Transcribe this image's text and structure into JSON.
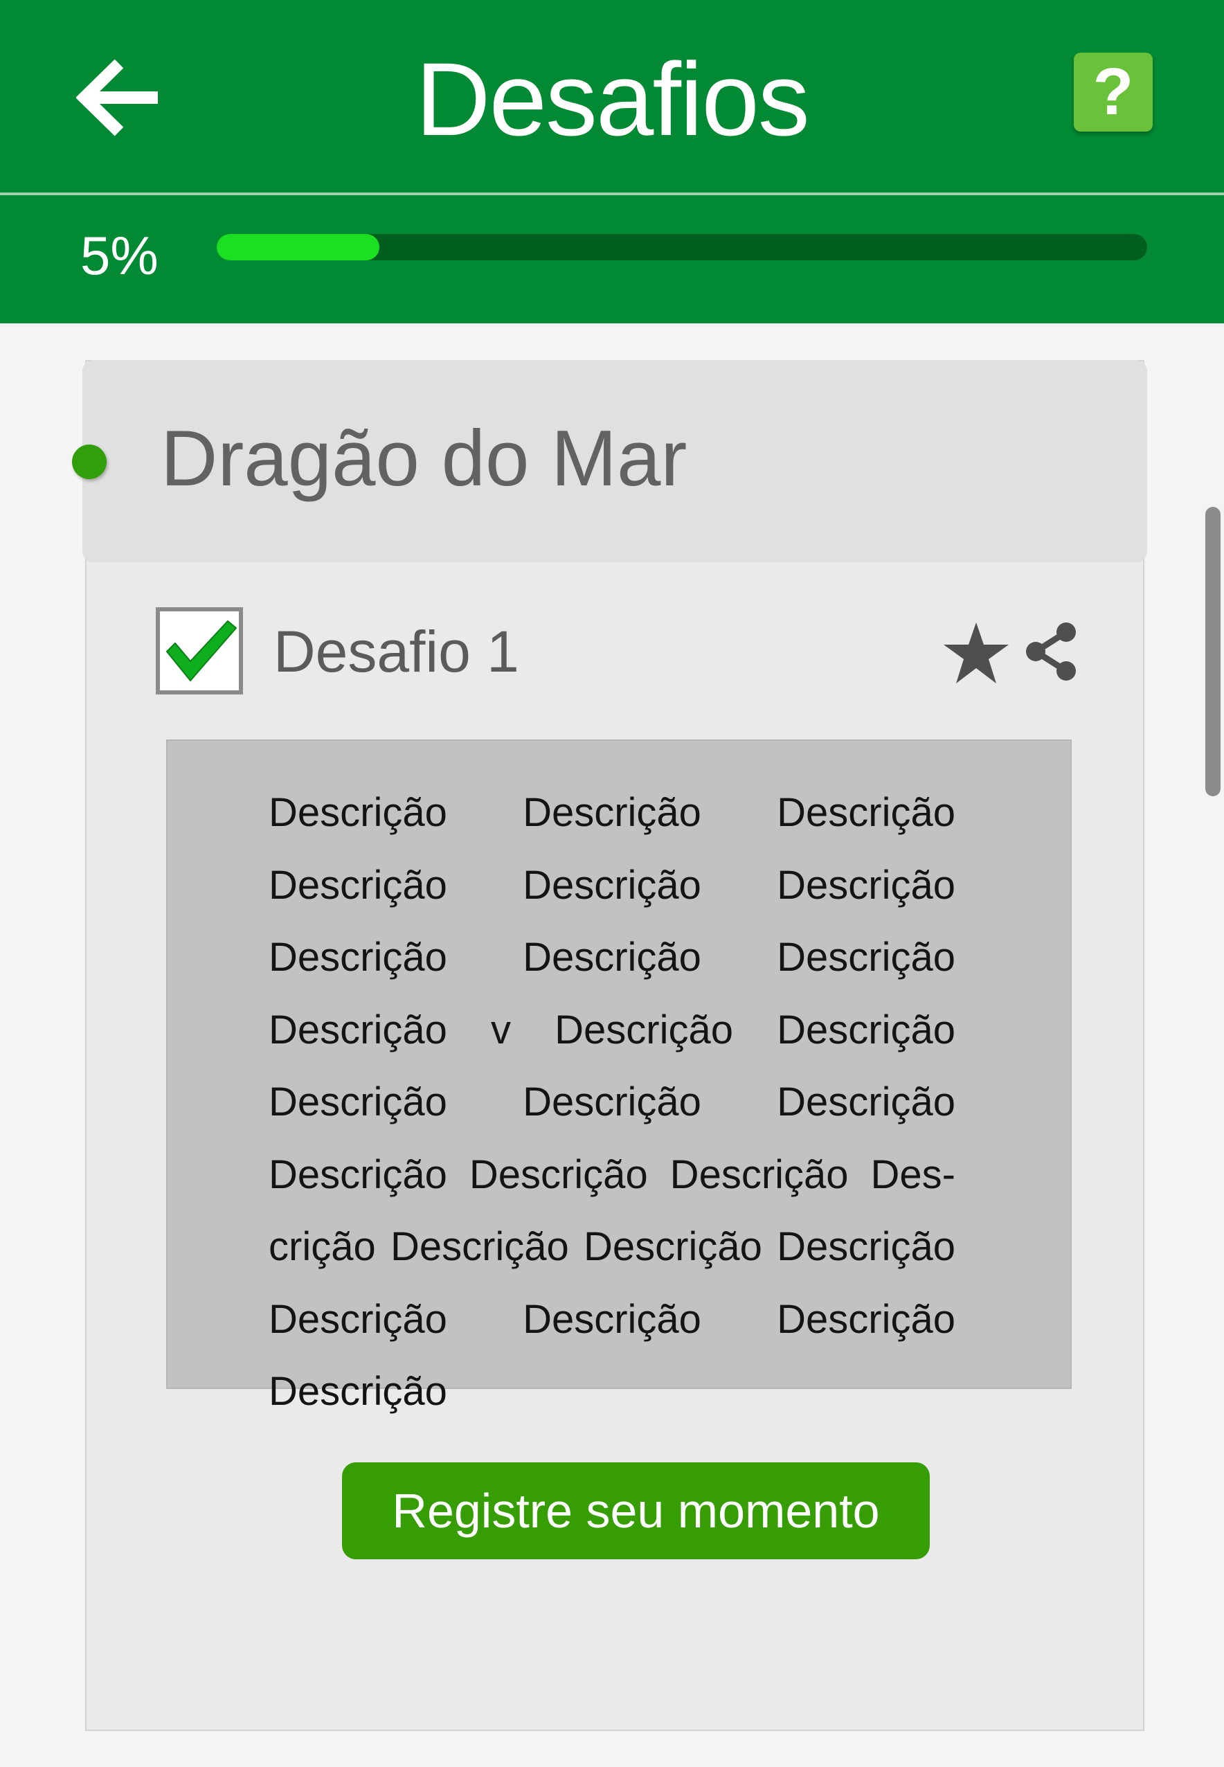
{
  "header": {
    "title": "Desafios",
    "back_icon": "arrow-left-icon",
    "help_label": "?",
    "help_icon": "question-mark-icon",
    "color": "#028934"
  },
  "progress": {
    "label": "5%",
    "value_percent": 5,
    "fill_color": "#1bdf22",
    "track_color": "#005e1f"
  },
  "section": {
    "title": "Dragão do Mar",
    "indicator_color": "#339e0b"
  },
  "challenge": {
    "name": "Desafio 1",
    "completed": true,
    "check_icon": "checkmark-icon",
    "favorite_icon": "star-icon",
    "share_icon": "share-icon",
    "description": "Descrição Descrição Descrição Descri­ção Descrição Descrição Descrição Des­crição Descrição Descrição v Descrição Descrição Descrição Descrição Descri­ção Descrição Descrição Descrição Des­crição Descrição Descrição Descrição Descrição Descrição Descrição Descri­ção",
    "action_label": "Registre seu momento",
    "action_color": "#369e04"
  }
}
